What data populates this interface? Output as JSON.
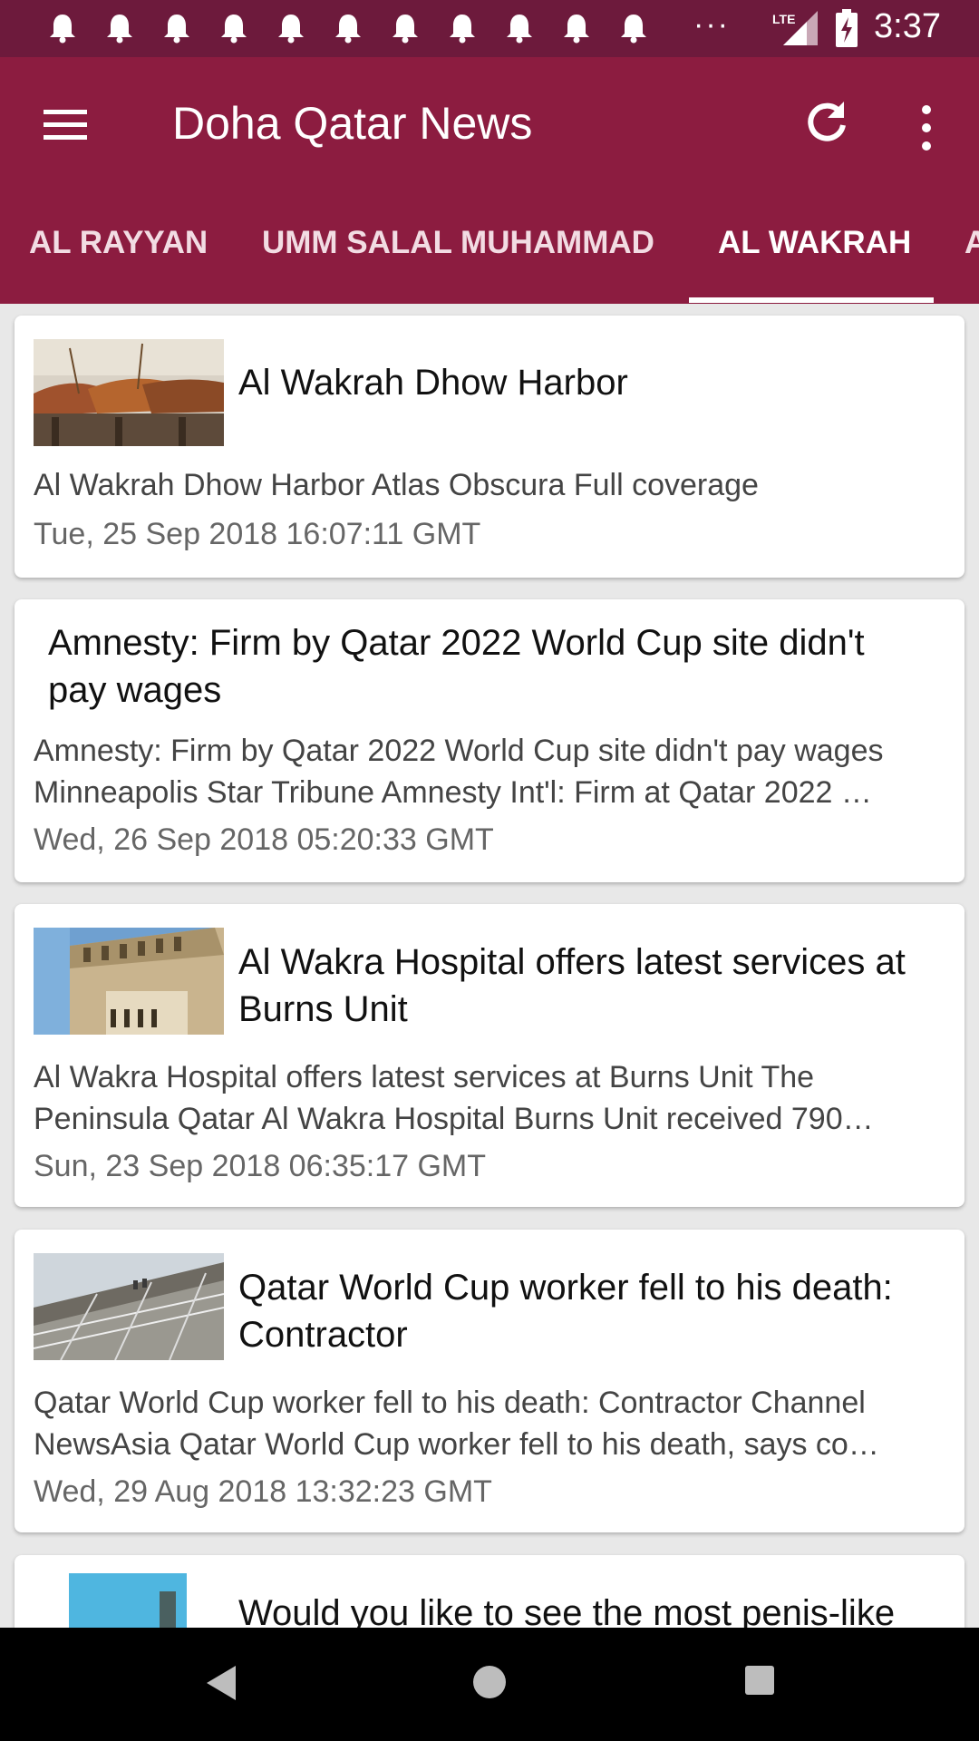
{
  "status_bar": {
    "time": "3:37",
    "overflow_dots": "···",
    "network": "LTE",
    "notification_icon": "bell-icon",
    "notification_count": 11
  },
  "app_bar": {
    "title": "Doha Qatar News",
    "menu_icon": "hamburger-menu-icon",
    "refresh_icon": "refresh-icon",
    "more_icon": "more-vert-icon"
  },
  "tabs": [
    {
      "label": "AL RAYYAN"
    },
    {
      "label": "UMM SALAL MUHAMMAD"
    },
    {
      "label": "AL WAKRAH",
      "active": true
    },
    {
      "label": "A"
    }
  ],
  "articles": [
    {
      "title": "Al Wakrah Dhow Harbor",
      "desc1": "Al Wakrah Dhow Harbor  Atlas Obscura  Full coverage",
      "desc2": "",
      "date": "Tue, 25 Sep 2018 16:07:11 GMT",
      "image": "dhow-boats-image"
    },
    {
      "title1": "Amnesty: Firm by Qatar 2022 World Cup site didn't",
      "title2": "pay wages",
      "desc1": "Amnesty: Firm by Qatar 2022 World Cup site didn't pay wages",
      "desc2": "Minneapolis Star Tribune  Amnesty Int'l: Firm at Qatar 2022 …",
      "date": "Wed, 26 Sep 2018 05:20:33 GMT"
    },
    {
      "title1": "Al Wakra Hospital offers latest services at",
      "title2": "Burns Unit",
      "desc1": "Al Wakra Hospital offers latest services at Burns Unit  The",
      "desc2": "Peninsula Qatar  Al Wakra Hospital Burns Unit received 790…",
      "date": "Sun, 23 Sep 2018 06:35:17 GMT",
      "image": "hospital-building-image"
    },
    {
      "title1": "Qatar World Cup worker fell to his death:",
      "title2": "Contractor",
      "desc1": "Qatar World Cup worker fell to his death: Contractor  Channel",
      "desc2": "NewsAsia  Qatar World Cup worker fell to his death, says co…",
      "date": "Wed, 29 Aug 2018 13:32:23 GMT",
      "image": "stadium-scaffold-image"
    },
    {
      "title1": "Would you like to see the most penis-like",
      "image": "sky-image"
    }
  ],
  "nav_bar": {
    "back_icon": "back-triangle-icon",
    "home_icon": "home-circle-icon",
    "recent_icon": "recents-square-icon"
  }
}
